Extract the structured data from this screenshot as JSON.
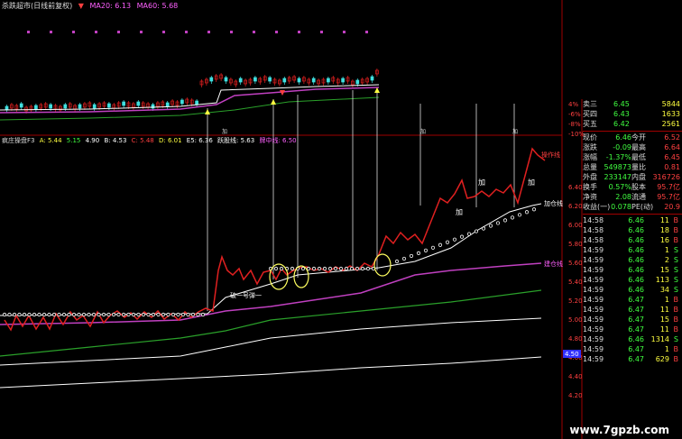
{
  "top_legend": {
    "name": "杀跌超市(日线前复权)",
    "ma20_label": "MA20: 6.13",
    "ma60_label": "MA60: 5.68"
  },
  "top_scale": [
    "4%",
    "-6%",
    "-8%",
    "-10%"
  ],
  "mid_legend": {
    "name": "疯庄操盘F3",
    "items": [
      "A: 5.44",
      "5.15",
      "4.90",
      "B: 4.53",
      "C: 5.48",
      "D: 6.01",
      "E5: 6.36",
      "跃股线: 5.63",
      "牌中线: 6.50"
    ]
  },
  "markers_top": [
    "加",
    "加",
    "加"
  ],
  "mid_price_scale": [
    "6.40",
    "6.20",
    "6.00",
    "5.80",
    "5.60",
    "5.40",
    "5.20",
    "5.00",
    "4.80",
    "4.60",
    "4.40",
    "4.20"
  ],
  "mid_price_highlight": "4.50",
  "annotations": {
    "operator_line": "操作线",
    "add_position_line": "加仓线",
    "build_line": "建仓线",
    "add": "加",
    "break_line": "破一号弹一"
  },
  "colors": {
    "price_red": "#e02020",
    "line_white": "#ffffff",
    "line_magenta": "#c040c0",
    "line_green": "#2aa02a",
    "line_yellow": "#ffff60",
    "accent_blue": "#3030ff"
  },
  "quote_panel": {
    "asks": [
      {
        "label": "卖三",
        "price": "6.45",
        "vol": "5844"
      },
      {
        "label": "买四",
        "price": "6.43",
        "vol": "1633"
      },
      {
        "label": "买五",
        "price": "6.42",
        "vol": "2561"
      }
    ],
    "stats": [
      {
        "l1": "现价",
        "v1": "6.46",
        "l2": "今开",
        "v2": "6.52"
      },
      {
        "l1": "涨跌",
        "v1": "-0.09",
        "l2": "最高",
        "v2": "6.64"
      },
      {
        "l1": "涨幅",
        "v1": "-1.37%",
        "l2": "最低",
        "v2": "6.45"
      },
      {
        "l1": "总量",
        "v1": "549873",
        "l2": "量比",
        "v2": "0.81"
      },
      {
        "l1": "外盘",
        "v1": "233147",
        "l2": "内盘",
        "v2": "316726"
      },
      {
        "l1": "换手",
        "v1": "0.57%",
        "l2": "股本",
        "v2": "95.7亿"
      },
      {
        "l1": "净资",
        "v1": "2.08",
        "l2": "流通",
        "v2": "95.7亿"
      },
      {
        "l1": "收益(一)",
        "v1": "0.078",
        "l2": "PE(动)",
        "v2": "20.9"
      }
    ],
    "ticks": [
      {
        "t": "14:58",
        "p": "6.46",
        "v": "11",
        "s": "B"
      },
      {
        "t": "14:58",
        "p": "6.46",
        "v": "18",
        "s": "B"
      },
      {
        "t": "14:58",
        "p": "6.46",
        "v": "16",
        "s": "B"
      },
      {
        "t": "14:59",
        "p": "6.46",
        "v": "1",
        "s": "S"
      },
      {
        "t": "14:59",
        "p": "6.46",
        "v": "2",
        "s": "S"
      },
      {
        "t": "14:59",
        "p": "6.46",
        "v": "15",
        "s": "S"
      },
      {
        "t": "14:59",
        "p": "6.46",
        "v": "113",
        "s": "S"
      },
      {
        "t": "14:59",
        "p": "6.46",
        "v": "34",
        "s": "S"
      },
      {
        "t": "14:59",
        "p": "6.47",
        "v": "1",
        "s": "B"
      },
      {
        "t": "14:59",
        "p": "6.47",
        "v": "11",
        "s": "B"
      },
      {
        "t": "14:59",
        "p": "6.47",
        "v": "15",
        "s": "B"
      },
      {
        "t": "14:59",
        "p": "6.47",
        "v": "11",
        "s": "B"
      },
      {
        "t": "14:59",
        "p": "6.46",
        "v": "1314",
        "s": "S"
      },
      {
        "t": "14:59",
        "p": "6.47",
        "v": "1",
        "s": "B"
      },
      {
        "t": "14:59",
        "p": "6.47",
        "v": "629",
        "s": "B"
      }
    ]
  },
  "watermark": "www.7gpzb.com"
}
